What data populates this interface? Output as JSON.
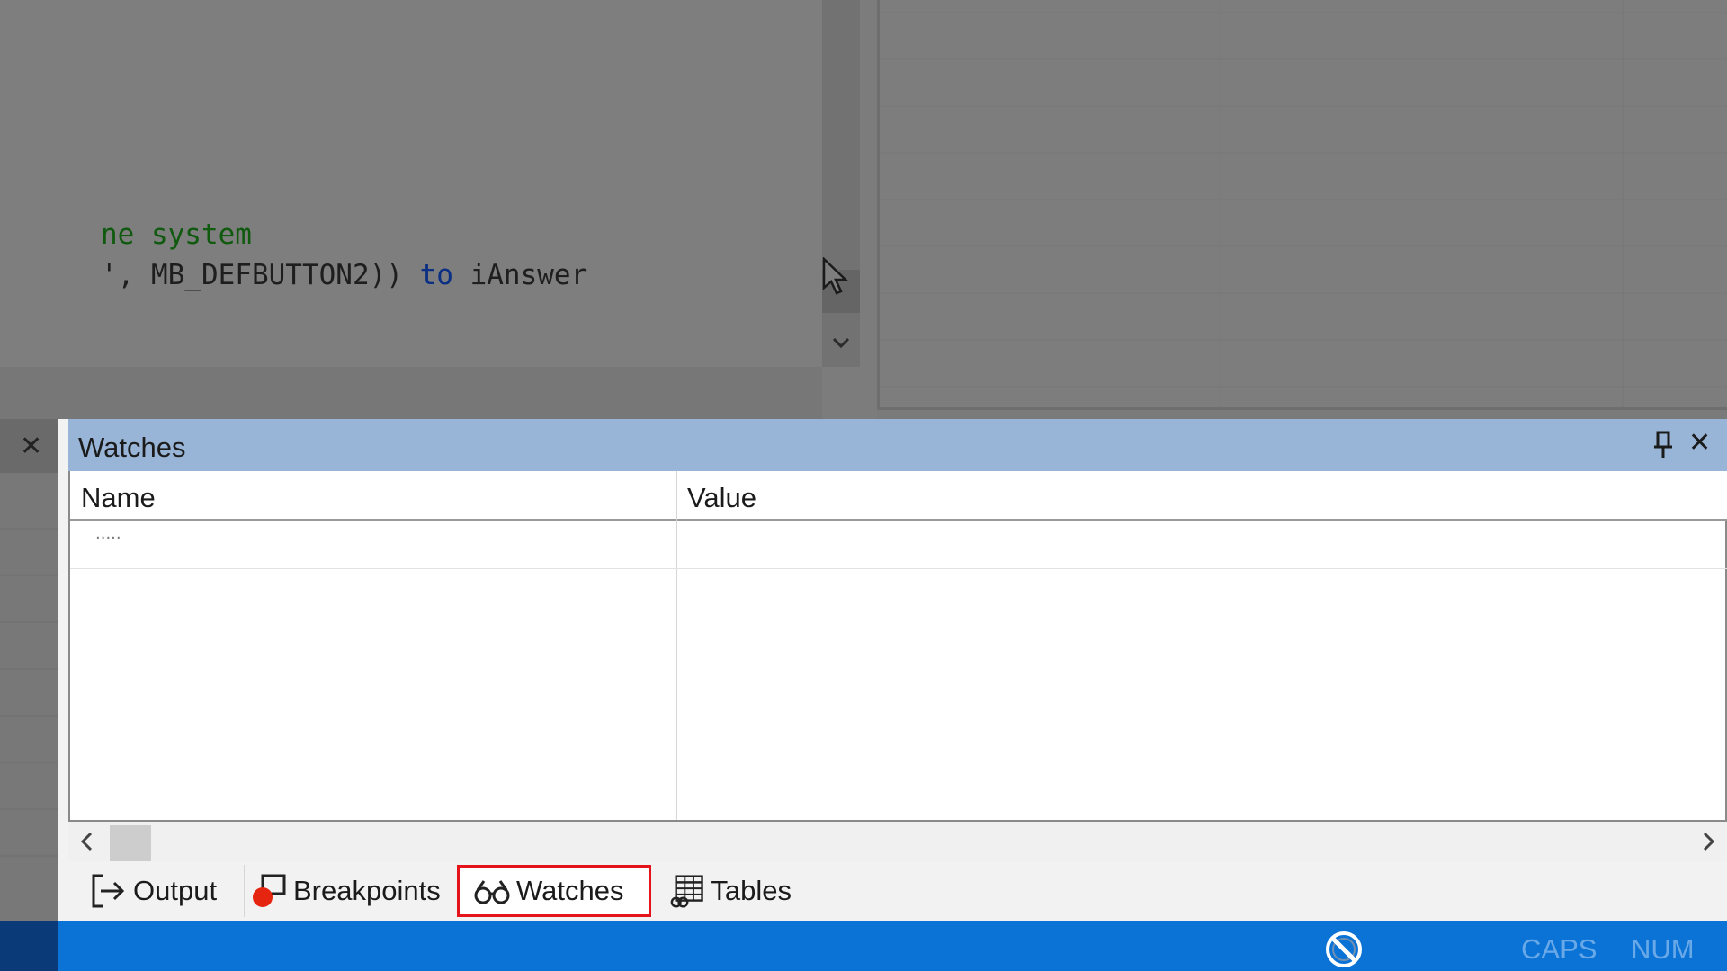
{
  "editor": {
    "line1": {
      "comment": "ne system"
    },
    "line2": {
      "pre": "', MB_DEFBUTTON2)) ",
      "keyword": "to",
      "post": " iAnswer"
    }
  },
  "watches_panel": {
    "title": "Watches",
    "columns": {
      "name": "Name",
      "value": "Value"
    },
    "rows": [
      {
        "name": ".....",
        "value": ""
      }
    ]
  },
  "tabs": [
    {
      "label": "Output",
      "icon": "output-icon"
    },
    {
      "label": "Breakpoints",
      "icon": "breakpoint-icon"
    },
    {
      "label": "Watches",
      "icon": "glasses-icon",
      "highlighted": true
    },
    {
      "label": "Tables",
      "icon": "table-icon"
    }
  ],
  "statusbar": {
    "caps": "CAPS",
    "num": "NUM"
  },
  "colors": {
    "title_bar": "#98b4d6",
    "status_bar": "#0b73d6",
    "highlight": "#e5141b",
    "breakpoint": "#e5250f"
  }
}
